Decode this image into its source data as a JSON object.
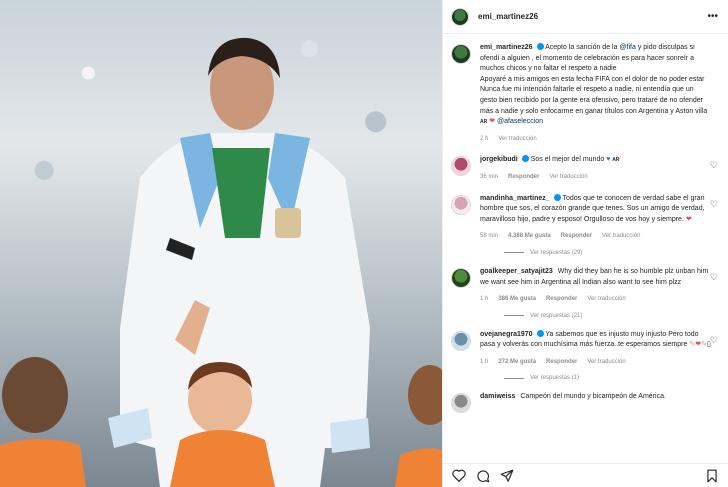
{
  "header": {
    "username": "emi_martinez26"
  },
  "caption": {
    "username": "emi_martinez26",
    "parts": [
      "Acepto la sanción de la ",
      "@fifa",
      " y pido disculpas si ofendí a alguien , el momento de celebración es para hacer sonreír a muchos chicos y no faltar el respeto a nadie",
      "Apoyaré a mis amigos en esta fecha FIFA con el dolor de no poder estar",
      "Nunca fue mi intención faltarle el respeto a nadie, ni entendía que un gesto bien recibido por la gente era ofensivo, pero trataré de no ofender más a nadie y solo enfocarme en ganar títulos con Argentina y Aston villa ",
      "AR",
      "@afaseleccion"
    ],
    "time": "2 h",
    "translate": "Ver traducción"
  },
  "comments": [
    {
      "username": "jorgekibudi",
      "text": "Sos el mejor del mundo",
      "flag": "AR",
      "time": "36 min",
      "reply": "Responder",
      "translate": "Ver traducción"
    },
    {
      "username": "mandinha_martinez_",
      "text": "Todos que te conocen de verdad sabe el gran hombre que sos, el corazón grande que tenes. Sos un amigo de verdad, maravilloso hijo, padre y esposo! Orgulloso de vos hoy y siempre.",
      "time": "58 min",
      "likes": "4.388 Me gusta",
      "reply": "Responder",
      "translate": "Ver traducción",
      "replies": "Ver respuestas (29)"
    },
    {
      "username": "goalkeeper_satyajit23",
      "text": "Why did they ban he is so humble plz unban him we want see him in Argentina all Indian also want to see him plzz",
      "time": "1 h",
      "likes": "386 Me gusta",
      "reply": "Responder",
      "translate": "Ver traducción",
      "replies": "Ver respuestas (21)"
    },
    {
      "username": "ovejanegra1970",
      "text": "Ya sabemos que es injusto muy injusto Pero todo pasa y volverás con muchísima más fuerza..te esperamos siempre",
      "time": "1 h",
      "likes": "272 Me gusta",
      "reply": "Responder",
      "translate": "Ver traducción",
      "replies": "Ver respuestas (1)"
    },
    {
      "username": "damiweiss",
      "text": "Campeón del mundo y bicampeón de América."
    }
  ],
  "colors": {
    "link": "#00376b",
    "meta": "#8e8e8e",
    "verified": "#0095f6",
    "like": "#ed4956"
  },
  "icons": {
    "more": "more-icon",
    "like": "heart-icon",
    "comment": "comment-icon",
    "share": "share-icon",
    "save": "bookmark-icon"
  }
}
